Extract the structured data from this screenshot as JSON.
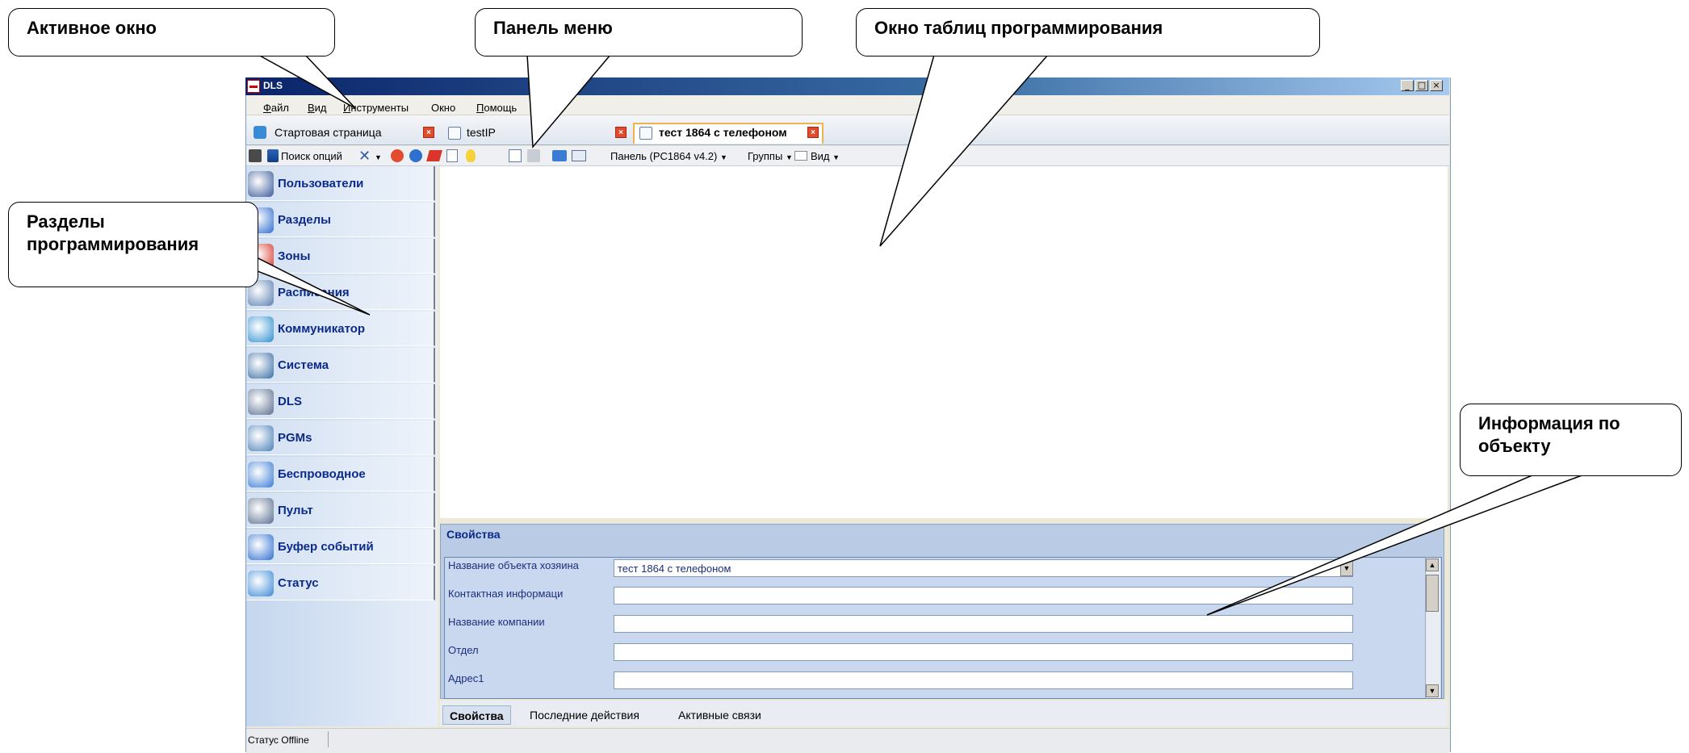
{
  "window": {
    "title": "DLS"
  },
  "menu": {
    "items": [
      {
        "underline": "Ф",
        "rest": "айл"
      },
      {
        "underline": "В",
        "rest": "ид"
      },
      {
        "underline": "И",
        "rest": "нструменты"
      },
      {
        "underline": "",
        "rest": "Окно"
      },
      {
        "underline": "П",
        "rest": "омощь"
      }
    ]
  },
  "tabs": [
    {
      "label": "Стартовая страница"
    },
    {
      "label": "testIP"
    },
    {
      "label": "тест 1864 с телефоном"
    }
  ],
  "toolbar": {
    "search_label": "Поиск опций",
    "panel_label": "Панель (PC1864 v4.2)",
    "groups_label": "Группы",
    "view_label": "Вид"
  },
  "sidebar": {
    "items": [
      {
        "label": "Пользователи",
        "icon": "users-icon"
      },
      {
        "label": "Разделы",
        "icon": "partitions-icon"
      },
      {
        "label": "Зоны",
        "icon": "zones-icon"
      },
      {
        "label": "Расписания",
        "icon": "calendar-icon"
      },
      {
        "label": "Коммуникатор",
        "icon": "phone-icon"
      },
      {
        "label": "Система",
        "icon": "system-icon"
      },
      {
        "label": "DLS",
        "icon": "dls-icon"
      },
      {
        "label": "PGMs",
        "icon": "pgm-icon"
      },
      {
        "label": "Беспроводное",
        "icon": "wireless-icon"
      },
      {
        "label": "Пульт",
        "icon": "keypad-icon"
      },
      {
        "label": "Буфер событий",
        "icon": "event-buffer-icon"
      },
      {
        "label": "Статус",
        "icon": "info-icon"
      }
    ]
  },
  "properties": {
    "title": "Свойства",
    "fields": [
      {
        "label": "Название объекта хозяина",
        "value": "тест 1864 с телефоном"
      },
      {
        "label": "Контактная информаци",
        "value": ""
      },
      {
        "label": "Название компании",
        "value": ""
      },
      {
        "label": "Отдел",
        "value": ""
      },
      {
        "label": "Адрес1",
        "value": ""
      }
    ]
  },
  "bottom_tabs": [
    "Свойства",
    "Последние действия",
    "Активные связи"
  ],
  "status": {
    "label": "Статус",
    "value": "Offline"
  },
  "callouts": {
    "active_window": "Активное окно",
    "menu_panel": "Панель меню",
    "tables_window": "Окно таблиц программирования",
    "sections": "Разделы программирования",
    "object_info": "Информация по объекту"
  },
  "colors": {
    "titlebar": "#0a246a",
    "nav_text": "#0b2a8a",
    "active_tab_border": "#f0b44d"
  }
}
